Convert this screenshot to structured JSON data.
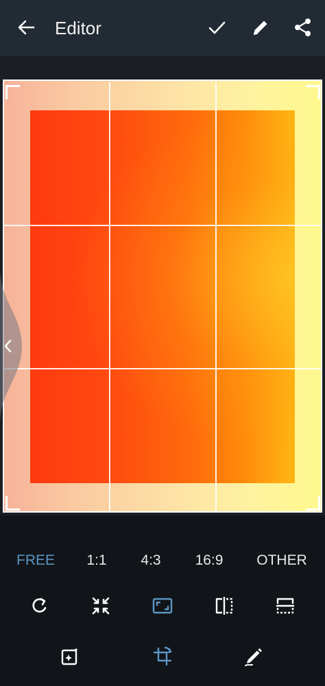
{
  "appbar": {
    "title": "Editor",
    "icons": [
      "arrow-back-icon",
      "check-icon",
      "pencil-icon",
      "share-icon"
    ]
  },
  "aspect_options": {
    "free": "FREE",
    "one_one": "1:1",
    "four_three": "4:3",
    "sixteen_nine": "16:9",
    "other": "OTHER",
    "selected": "FREE"
  },
  "tools": [
    "rotate-icon",
    "shrink-icon",
    "aspect-frame-icon",
    "flip-horizontal-icon",
    "flip-vertical-icon"
  ],
  "bottom_tabs": [
    "auto-enhance-icon",
    "crop-rotate-icon",
    "draw-icon"
  ],
  "colors": {
    "appbar_bg": "#222a33",
    "accent": "#5b96c4",
    "background": "#111418"
  }
}
